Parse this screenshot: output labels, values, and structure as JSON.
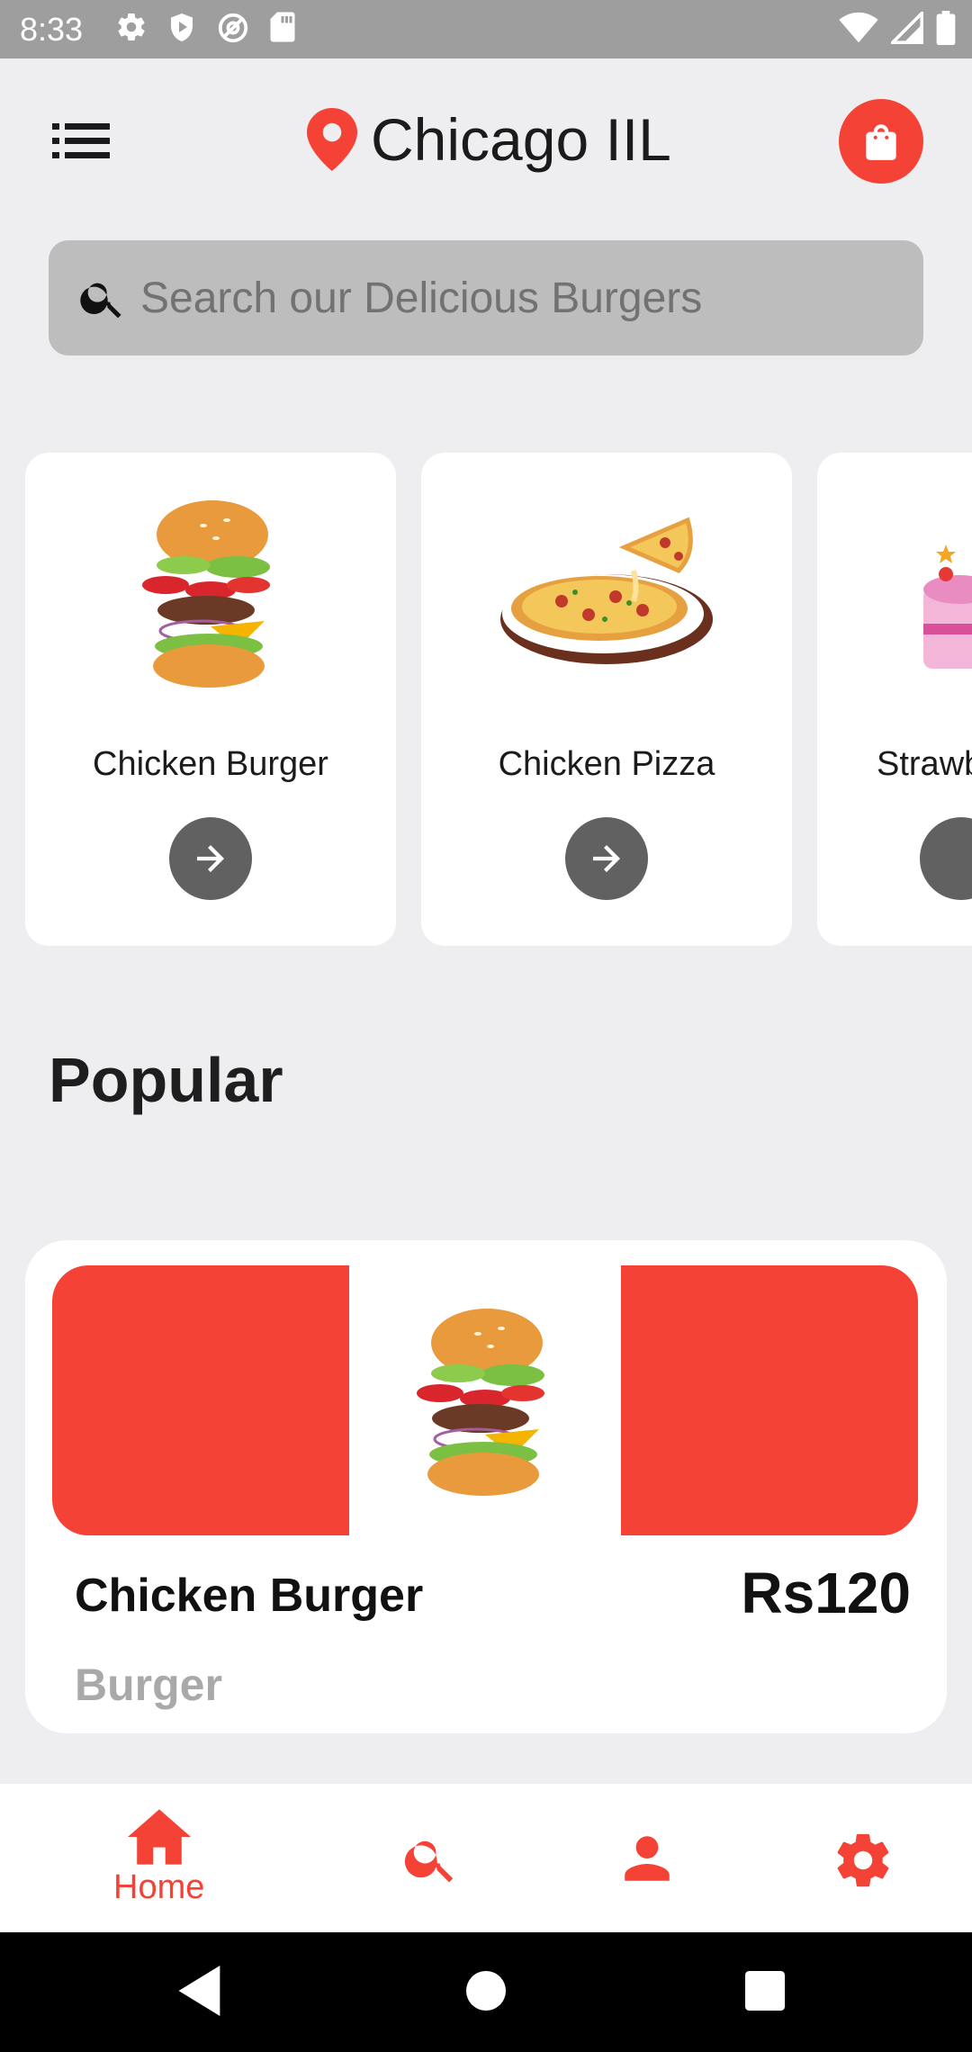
{
  "status_bar": {
    "time": "8:33",
    "left_icons": [
      "settings-icon",
      "shield-play-icon",
      "at-sign-icon",
      "sd-card-icon"
    ],
    "right_icons": [
      "wifi-icon",
      "cell-signal-icon",
      "battery-icon"
    ]
  },
  "header": {
    "menu_icon": "list-menu-icon",
    "location_icon": "map-pin-icon",
    "city": "Chicago IIL",
    "cart_icon": "shopping-bag-icon"
  },
  "search": {
    "placeholder": "Search our Delicious Burgers",
    "icon": "search-icon"
  },
  "categories": [
    {
      "name": "Chicken Burger",
      "image": "burger-illustration"
    },
    {
      "name": "Chicken Pizza",
      "image": "pizza-illustration"
    },
    {
      "name": "Strawb",
      "image": "cake-illustration"
    }
  ],
  "popular": {
    "title": "Popular",
    "item": {
      "name": "Chicken Burger",
      "price": "Rs120",
      "category": "Burger",
      "image": "burger-illustration"
    }
  },
  "bottom_nav": {
    "items": [
      {
        "label": "Home",
        "icon": "home-icon",
        "active": true
      },
      {
        "label": "",
        "icon": "search-icon"
      },
      {
        "label": "",
        "icon": "person-icon"
      },
      {
        "label": "",
        "icon": "settings-icon"
      }
    ]
  },
  "colors": {
    "accent": "#F44336",
    "background": "#EEEDEF",
    "search_bg": "#BDBDBD",
    "arrow_button": "#616161"
  }
}
